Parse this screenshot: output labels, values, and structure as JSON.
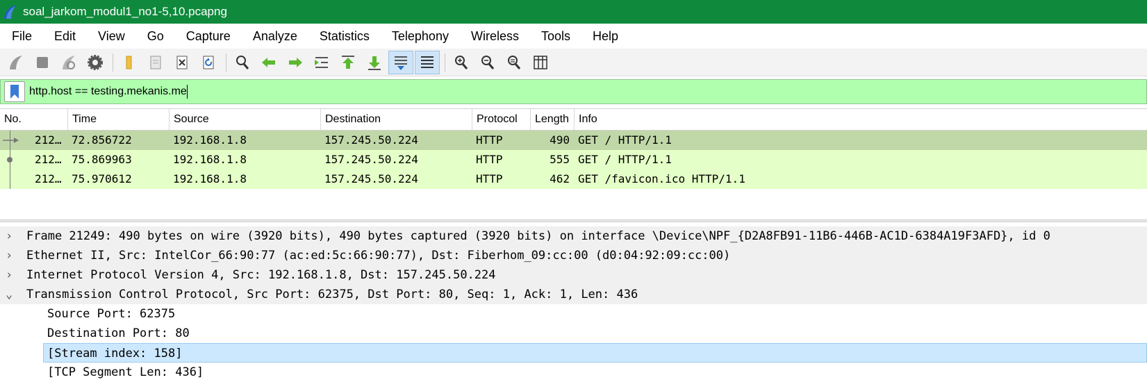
{
  "window": {
    "title": "soal_jarkom_modul1_no1-5,10.pcapng"
  },
  "menu": [
    "File",
    "Edit",
    "View",
    "Go",
    "Capture",
    "Analyze",
    "Statistics",
    "Telephony",
    "Wireless",
    "Tools",
    "Help"
  ],
  "toolbar": {
    "icons": [
      "start-capture-icon",
      "stop-capture-icon",
      "restart-capture-icon",
      "capture-options-icon",
      "open-file-icon",
      "save-file-icon",
      "close-file-icon",
      "reload-file-icon",
      "find-packet-icon",
      "go-back-icon",
      "go-forward-icon",
      "go-to-packet-icon",
      "go-first-packet-icon",
      "go-last-packet-icon",
      "autoscroll-icon",
      "colorize-icon",
      "zoom-in-icon",
      "zoom-out-icon",
      "normal-size-icon",
      "resize-columns-icon"
    ]
  },
  "filter": {
    "value": "http.host == testing.mekanis.me",
    "background": "#afffaf"
  },
  "packet_list": {
    "columns": [
      "No.",
      "Time",
      "Source",
      "Destination",
      "Protocol",
      "Length",
      "Info"
    ],
    "rows": [
      {
        "no": "212…",
        "time": "72.856722",
        "source": "192.168.1.8",
        "destination": "157.245.50.224",
        "protocol": "HTTP",
        "length": "490",
        "info": "GET / HTTP/1.1"
      },
      {
        "no": "212…",
        "time": "75.869963",
        "source": "192.168.1.8",
        "destination": "157.245.50.224",
        "protocol": "HTTP",
        "length": "555",
        "info": "GET / HTTP/1.1"
      },
      {
        "no": "212…",
        "time": "75.970612",
        "source": "192.168.1.8",
        "destination": "157.245.50.224",
        "protocol": "HTTP",
        "length": "462",
        "info": "GET /favicon.ico HTTP/1.1"
      }
    ],
    "row_color": "#e4ffc7",
    "selected_color": "#c0d8a8"
  },
  "details": {
    "rows": [
      {
        "arrow": "›",
        "text": "Frame 21249: 490 bytes on wire (3920 bits), 490 bytes captured (3920 bits) on interface \\Device\\NPF_{D2A8FB91-11B6-446B-AC1D-6384A19F3AFD}, id 0"
      },
      {
        "arrow": "›",
        "text": "Ethernet II, Src: IntelCor_66:90:77 (ac:ed:5c:66:90:77), Dst: Fiberhom_09:cc:00 (d0:04:92:09:cc:00)"
      },
      {
        "arrow": "›",
        "text": "Internet Protocol Version 4, Src: 192.168.1.8, Dst: 157.245.50.224"
      },
      {
        "arrow": "⌄",
        "text": "Transmission Control Protocol, Src Port: 62375, Dst Port: 80, Seq: 1, Ack: 1, Len: 436"
      },
      {
        "text": "Source Port: 62375"
      },
      {
        "text": "Destination Port: 80"
      },
      {
        "text": "[Stream index: 158]"
      },
      {
        "text": "[TCP Segment Len: 436]"
      }
    ]
  }
}
